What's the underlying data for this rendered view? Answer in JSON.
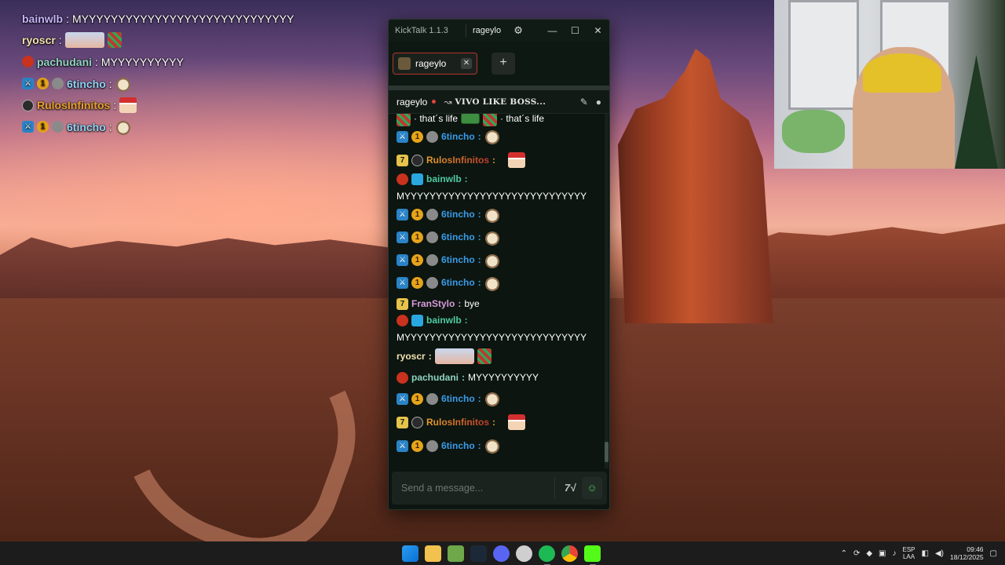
{
  "overlay_chat": [
    {
      "user": "bainwlb",
      "user_color": "#c8b4ff",
      "text": "MYYYYYYYYYYYYYYYYYYYYYYYYYYYYY",
      "badges": []
    },
    {
      "user": "ryoscr",
      "user_color": "#f3e1b0",
      "text": "",
      "badges": []
    },
    {
      "user": "pachudani",
      "user_color": "#8fd3c0",
      "text": "MYYYYYYYYYY",
      "badges": [
        "red"
      ]
    },
    {
      "user": "6tincho",
      "user_color": "#8fd3f6",
      "text": "",
      "badges": [
        "sword",
        "one",
        "gray"
      ]
    },
    {
      "user": "RulosInfinitos",
      "user_color": "#e8a02d",
      "text": "",
      "badges": [
        "skull"
      ]
    },
    {
      "user": "6tincho",
      "user_color": "#8fd3f6",
      "text": "",
      "badges": [
        "sword",
        "one",
        "gray"
      ]
    }
  ],
  "window": {
    "app_title": "KickTalk 1.1.3",
    "username": "rageylo",
    "gear_icon": "gear-icon",
    "min": "—",
    "max": "☐",
    "close": "✕"
  },
  "tabs": [
    {
      "label": "rageylo",
      "close": "✕"
    }
  ],
  "add_tab": "+",
  "channel": {
    "name": "rageylo",
    "stream_title": "VIVO LIKE BOSS...",
    "pin_icon": "pin-icon",
    "user_icon": "user-icon"
  },
  "messages": [
    {
      "parts": " · that´s life",
      "parts2": " · that´s life"
    },
    {
      "user": "6tincho",
      "sep": ":"
    },
    {
      "user": "RulosInfinitos",
      "sep": ":"
    },
    {
      "user": "bainwlb",
      "sep": ":",
      "text": "MYYYYYYYYYYYYYYYYYYYYYYYYYYYYY"
    },
    {
      "user": "6tincho",
      "sep": ":"
    },
    {
      "user": "6tincho",
      "sep": ":"
    },
    {
      "user": "6tincho",
      "sep": ":"
    },
    {
      "user": "6tincho",
      "sep": ":"
    },
    {
      "user": "FranStylo",
      "sep": ":",
      "text": "bye"
    },
    {
      "user": "bainwlb",
      "sep": ":",
      "text": "MYYYYYYYYYYYYYYYYYYYYYYYYYYYYY"
    },
    {
      "user": "ryoscr",
      "sep": ":"
    },
    {
      "user": "pachudani",
      "sep": ":",
      "text": "MYYYYYYYYYY"
    },
    {
      "user": "6tincho",
      "sep": ":"
    },
    {
      "user": "RulosInfinitos",
      "sep": ":"
    },
    {
      "user": "6tincho",
      "sep": ":"
    }
  ],
  "input": {
    "placeholder": "Send a message...",
    "kick_emote_label": "7√",
    "emoji_label": "☺"
  },
  "taskbar": {
    "lang_top": "ESP",
    "lang_bottom": "LAA",
    "time": "09:46",
    "date": "18/12/2025"
  },
  "colors": {
    "accent_red": "#b3342a",
    "tincho": "#3a9be6",
    "bainwlb": "#4fc9a2",
    "franstylo": "#d79bd9"
  }
}
